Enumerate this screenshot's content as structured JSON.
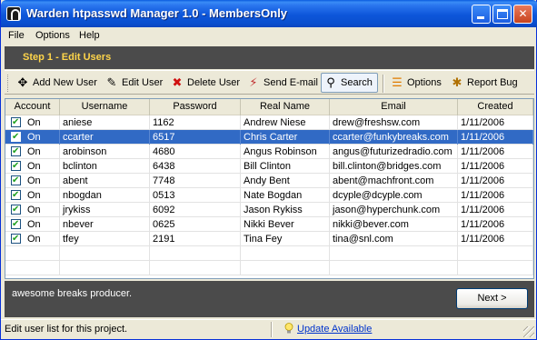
{
  "window": {
    "title": "Warden htpasswd Manager 1.0 - MembersOnly"
  },
  "menu": {
    "file": "File",
    "options": "Options",
    "help": "Help"
  },
  "step": {
    "title": "Step 1 - Edit Users"
  },
  "toolbar": {
    "add": "Add New User",
    "edit": "Edit User",
    "delete": "Delete User",
    "email": "Send E-mail",
    "search": "Search",
    "options": "Options",
    "bug": "Report Bug"
  },
  "table": {
    "columns": [
      "Account",
      "Username",
      "Password",
      "Real Name",
      "Email",
      "Created"
    ],
    "rows": [
      {
        "account": "On",
        "username": "aniese",
        "password": "1162",
        "realname": "Andrew Niese",
        "email": "drew@freshsw.com",
        "created": "1/11/2006"
      },
      {
        "account": "On",
        "username": "ccarter",
        "password": "6517",
        "realname": "Chris Carter",
        "email": "ccarter@funkybreaks.com",
        "created": "1/11/2006"
      },
      {
        "account": "On",
        "username": "arobinson",
        "password": "4680",
        "realname": "Angus Robinson",
        "email": "angus@futurizedradio.com",
        "created": "1/11/2006"
      },
      {
        "account": "On",
        "username": "bclinton",
        "password": "6438",
        "realname": "Bill Clinton",
        "email": "bill.clinton@bridges.com",
        "created": "1/11/2006"
      },
      {
        "account": "On",
        "username": "abent",
        "password": "7748",
        "realname": "Andy Bent",
        "email": "abent@machfront.com",
        "created": "1/11/2006"
      },
      {
        "account": "On",
        "username": "nbogdan",
        "password": "0513",
        "realname": "Nate Bogdan",
        "email": "dcyple@dcyple.com",
        "created": "1/11/2006"
      },
      {
        "account": "On",
        "username": "jrykiss",
        "password": "6092",
        "realname": "Jason Rykiss",
        "email": "jason@hyperchunk.com",
        "created": "1/11/2006"
      },
      {
        "account": "On",
        "username": "nbever",
        "password": "0625",
        "realname": "Nikki Bever",
        "email": "nikki@bever.com",
        "created": "1/11/2006"
      },
      {
        "account": "On",
        "username": "tfey",
        "password": "2191",
        "realname": "Tina Fey",
        "email": "tina@snl.com",
        "created": "1/11/2006"
      }
    ],
    "selected_row": 1
  },
  "notes": {
    "text": "awesome breaks producer."
  },
  "next_button": "Next >",
  "status": {
    "text": "Edit user list for this project.",
    "update_link": "Update Available"
  },
  "colors": {
    "titlebar": "#0A4FCF",
    "selection": "#316AC5",
    "step_text": "#FFD54A",
    "dark_panel": "#4B4B4B"
  }
}
